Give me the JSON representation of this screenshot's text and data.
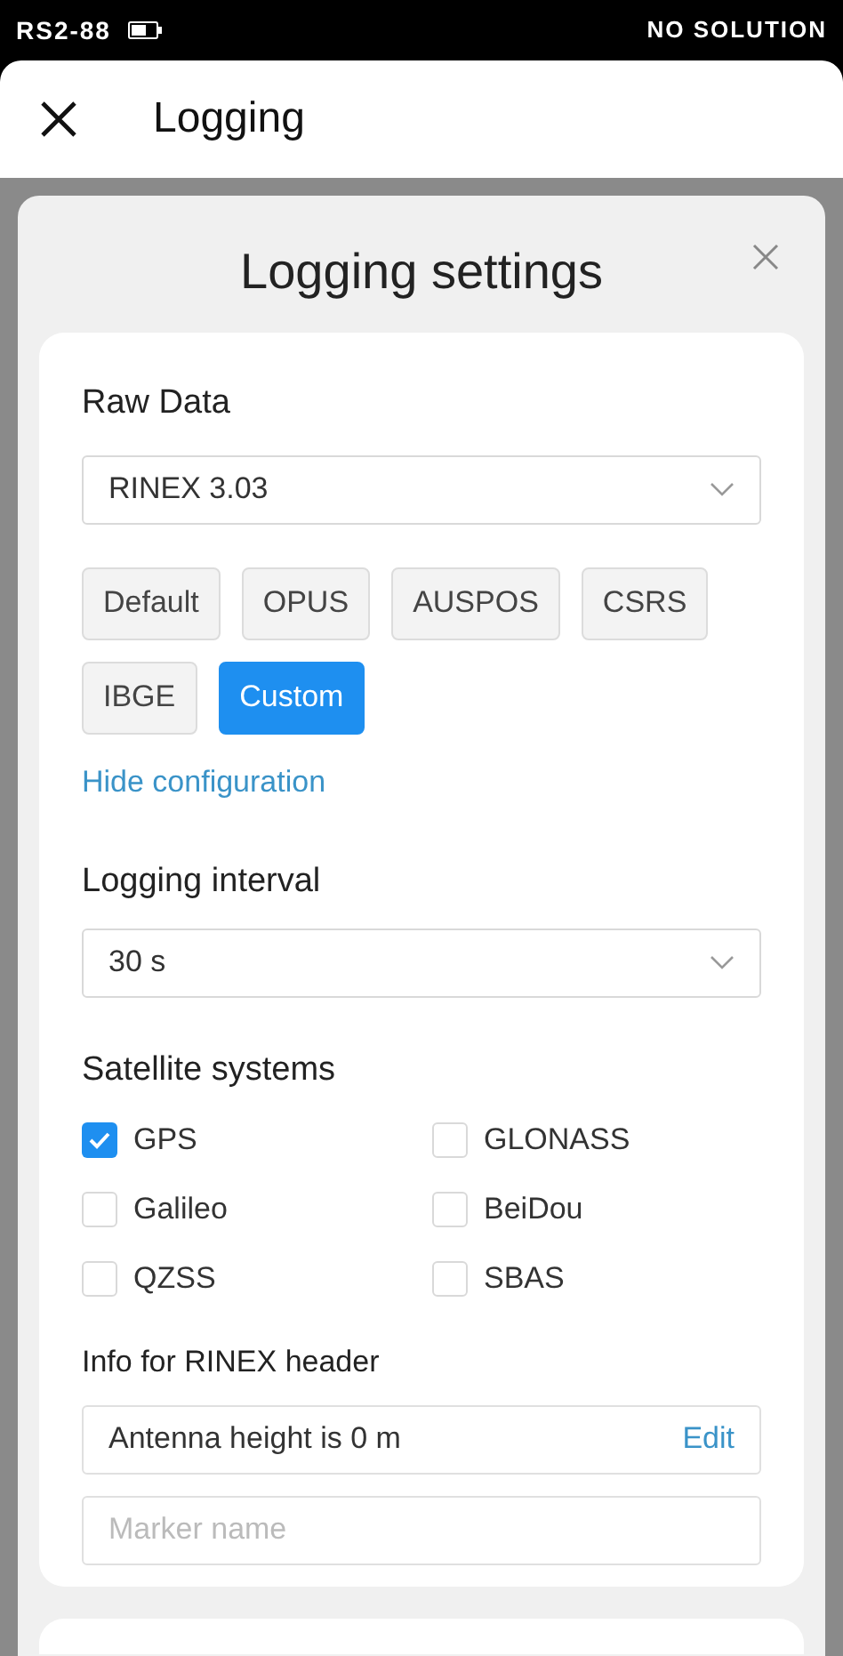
{
  "status_bar": {
    "device": "RS2-88",
    "solution": "NO SOLUTION"
  },
  "header": {
    "title": "Logging"
  },
  "dialog": {
    "title": "Logging settings",
    "raw_data": {
      "label": "Raw Data",
      "format": "RINEX 3.03",
      "presets": [
        {
          "label": "Default",
          "selected": false
        },
        {
          "label": "OPUS",
          "selected": false
        },
        {
          "label": "AUSPOS",
          "selected": false
        },
        {
          "label": "CSRS",
          "selected": false
        },
        {
          "label": "IBGE",
          "selected": false
        },
        {
          "label": "Custom",
          "selected": true
        }
      ],
      "toggle_link": "Hide configuration"
    },
    "interval": {
      "label": "Logging interval",
      "value": "30 s"
    },
    "satellites": {
      "label": "Satellite systems",
      "systems": [
        {
          "name": "GPS",
          "checked": true
        },
        {
          "name": "GLONASS",
          "checked": false
        },
        {
          "name": "Galileo",
          "checked": false
        },
        {
          "name": "BeiDou",
          "checked": false
        },
        {
          "name": "QZSS",
          "checked": false
        },
        {
          "name": "SBAS",
          "checked": false
        }
      ]
    },
    "rinex_header": {
      "label": "Info for RINEX header",
      "antenna": "Antenna height is 0 m",
      "edit": "Edit",
      "marker_placeholder": "Marker name"
    }
  }
}
